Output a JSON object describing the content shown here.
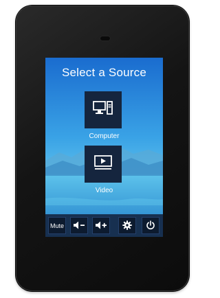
{
  "screen": {
    "title": "Select a Source"
  },
  "sources": [
    {
      "label": "Computer",
      "icon": "computer-icon"
    },
    {
      "label": "Video",
      "icon": "video-play-icon"
    }
  ],
  "controls": {
    "mute_label": "Mute",
    "volume_down_icon": "volume-down-icon",
    "volume_up_icon": "volume-up-icon",
    "settings_icon": "gear-icon",
    "power_icon": "power-icon"
  },
  "colors": {
    "tile": "#15253e",
    "control_bar": "#173050",
    "control_button": "#0d1b2f",
    "sky_top": "#1b6fd0",
    "sky_bottom": "#6fd3f0"
  }
}
